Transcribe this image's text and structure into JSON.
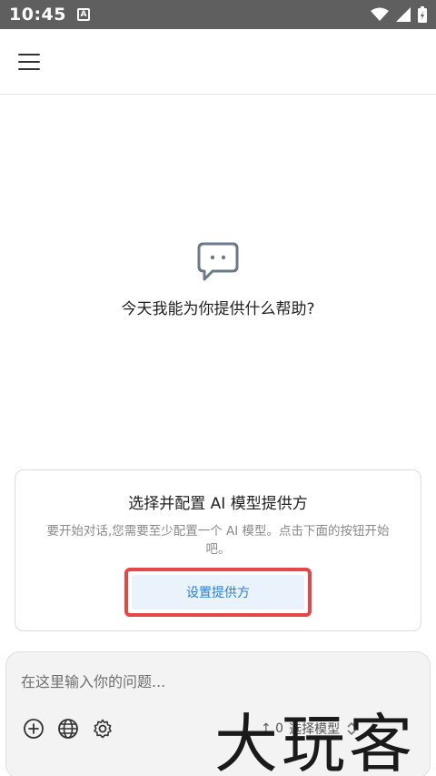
{
  "status": {
    "time": "10:45",
    "notification_icon": "a-icon"
  },
  "main": {
    "prompt_title": "今天我能为你提供什么帮助?"
  },
  "provider_card": {
    "title": "选择并配置 AI 模型提供方",
    "description": "要开始对话,您需要至少配置一个 AI 模型。点击下面的按钮开始吧。",
    "button_label": "设置提供方"
  },
  "composer": {
    "placeholder": "在这里输入你的问题...",
    "model_count": "↑ 0",
    "model_select": "选择模型"
  },
  "watermark": {
    "text": "大玩客"
  },
  "colors": {
    "status_bar": "#5f5f5f",
    "accent": "#2f7fd0",
    "highlight": "#e64646"
  }
}
